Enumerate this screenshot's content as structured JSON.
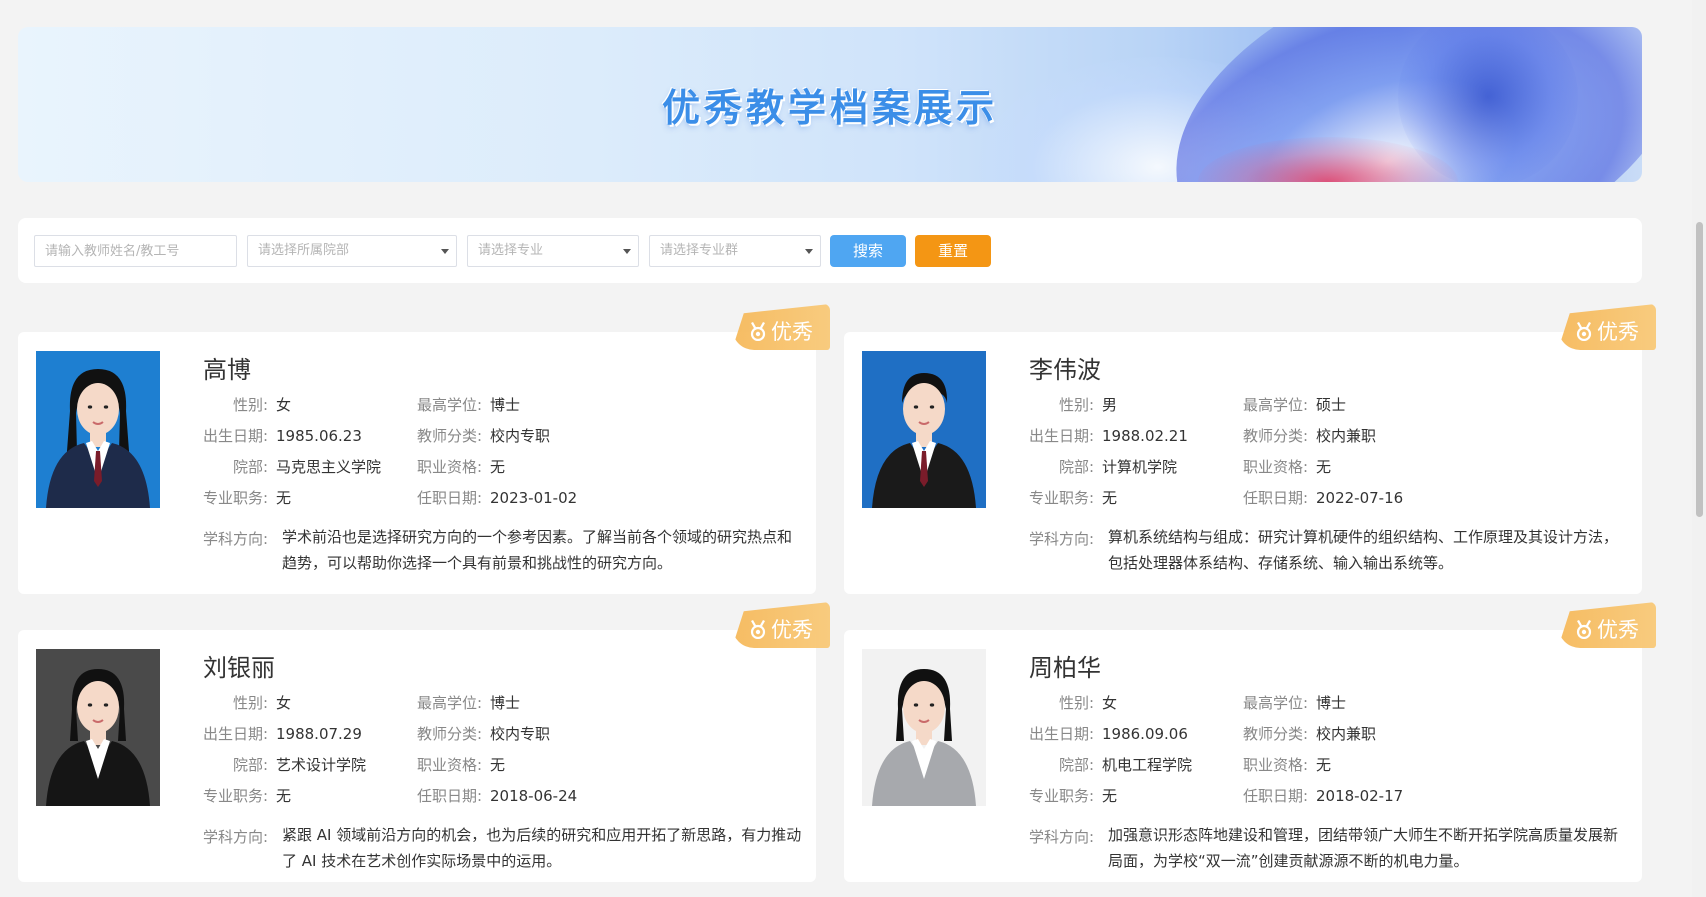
{
  "banner": {
    "title": "优秀教学档案展示"
  },
  "filters": {
    "name_placeholder": "请输入教师姓名/教工号",
    "department_placeholder": "请选择所属院部",
    "major_placeholder": "请选择专业",
    "major_group_placeholder": "请选择专业群",
    "search_label": "搜索",
    "reset_label": "重置"
  },
  "badge_label": "优秀",
  "labels": {
    "gender": "性别:",
    "degree": "最高学位:",
    "birth": "出生日期:",
    "category": "教师分类:",
    "department": "院部:",
    "qualification": "职业资格:",
    "title": "专业职务:",
    "hire_date": "任职日期:",
    "direction": "学科方向:"
  },
  "teachers": [
    {
      "name": "高博",
      "gender": "女",
      "degree": "博士",
      "birth": "1985.06.23",
      "category": "校内专职",
      "department": "马克思主义学院",
      "qualification": "无",
      "title": "无",
      "hire_date": "2023-01-02",
      "direction": "学术前沿也是选择研究方向的一个参考因素。了解当前各个领域的研究热点和趋势，可以帮助你选择一个具有前景和挑战性的研究方向。",
      "photo_bg": "#1e7fd1",
      "suit": "#1e2b4a"
    },
    {
      "name": "李伟波",
      "gender": "男",
      "degree": "硕士",
      "birth": "1988.02.21",
      "category": "校内兼职",
      "department": "计算机学院",
      "qualification": "无",
      "title": "无",
      "hire_date": "2022-07-16",
      "direction": "算机系统结构与组成：研究计算机硬件的组织结构、工作原理及其设计方法，包括处理器体系结构、存储系统、输入输出系统等。",
      "photo_bg": "#1f6fc4",
      "suit": "#1a1a1a"
    },
    {
      "name": "刘银丽",
      "gender": "女",
      "degree": "博士",
      "birth": "1988.07.29",
      "category": "校内专职",
      "department": "艺术设计学院",
      "qualification": "无",
      "title": "无",
      "hire_date": "2018-06-24",
      "direction": "紧跟 AI 领域前沿方向的机会，也为后续的研究和应用开拓了新思路，有力推动了 AI 技术在艺术创作实际场景中的运用。",
      "photo_bg": "#4a4a4a",
      "suit": "#151515"
    },
    {
      "name": "周柏华",
      "gender": "女",
      "degree": "博士",
      "birth": "1986.09.06",
      "category": "校内兼职",
      "department": "机电工程学院",
      "qualification": "无",
      "title": "无",
      "hire_date": "2018-02-17",
      "direction": "加强意识形态阵地建设和管理，团结带领广大师生不断开拓学院高质量发展新局面，为学校“双一流”创建贡献源源不断的机电力量。",
      "photo_bg": "#f2f2f2",
      "suit": "#a7a9ad"
    }
  ]
}
